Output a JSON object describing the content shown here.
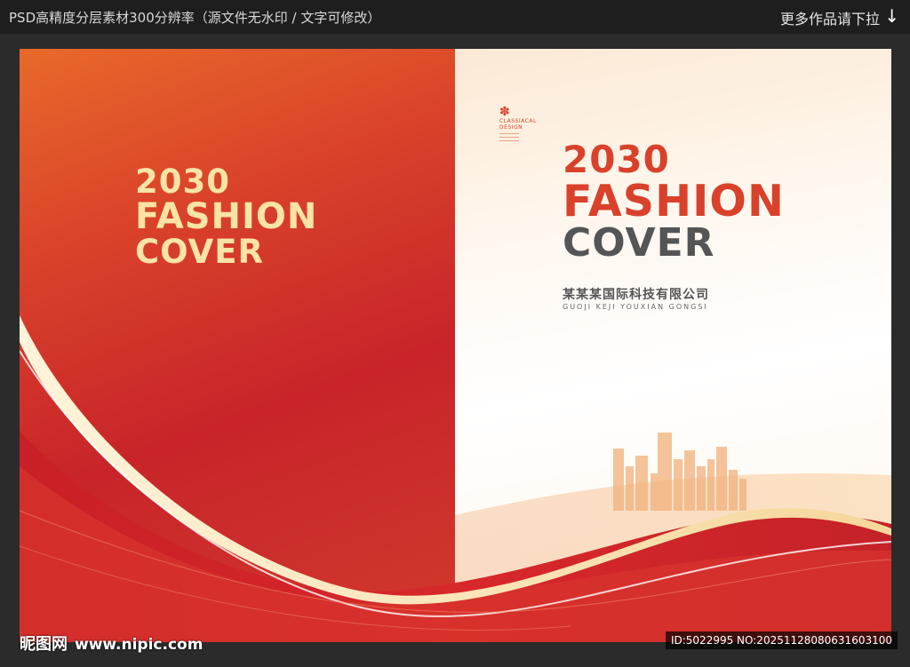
{
  "topbar": {
    "left_text": "PSD高精度分层素材300分辨率（源文件无水印 / 文字可修改）",
    "right_text": "更多作品请下拉",
    "arrow_icon": "arrow-down-icon"
  },
  "left_cover": {
    "year": "2030",
    "line1": "FASHION",
    "line2": "COVER"
  },
  "right_cover": {
    "logo_text_1": "CLASSIACAL",
    "logo_text_2": "DESIGN",
    "year": "2030",
    "line1": "FASHION",
    "line2": "COVER",
    "company": "某某某国际科技有限公司",
    "company_pinyin": "GUOJI KEJI YOUXIAN GONGSI"
  },
  "watermark": {
    "site_name": "昵图网",
    "url": "www.nipic.com",
    "id_text": "ID:5022995 NO:20251128080631603100"
  },
  "colors": {
    "red": "#d9412a",
    "cream": "#fbe3a6",
    "gray": "#555555"
  }
}
